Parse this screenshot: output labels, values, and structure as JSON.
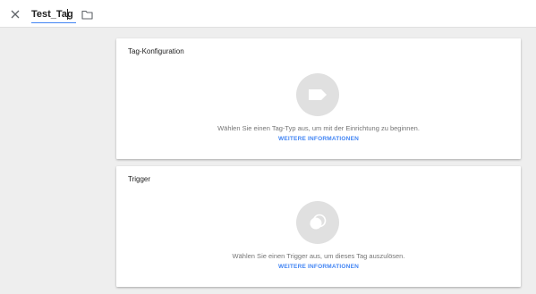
{
  "header": {
    "title_value": "Test_Tag",
    "close_icon": "close-icon",
    "folder_icon": "folder-icon"
  },
  "tag_card": {
    "title": "Tag-Konfiguration",
    "icon": "tag-icon",
    "description": "Wählen Sie einen Tag-Typ aus, um mit der Einrichtung zu beginnen.",
    "link": "WEITERE INFORMATIONEN"
  },
  "trigger_card": {
    "title": "Trigger",
    "icon": "trigger-icon",
    "description": "Wählen Sie einen Trigger aus, um dieses Tag auszulösen.",
    "link": "WEITERE INFORMATIONEN"
  },
  "colors": {
    "accent": "#4285f4",
    "background": "#eeeeee",
    "icon_circle": "#e0e0e0"
  }
}
